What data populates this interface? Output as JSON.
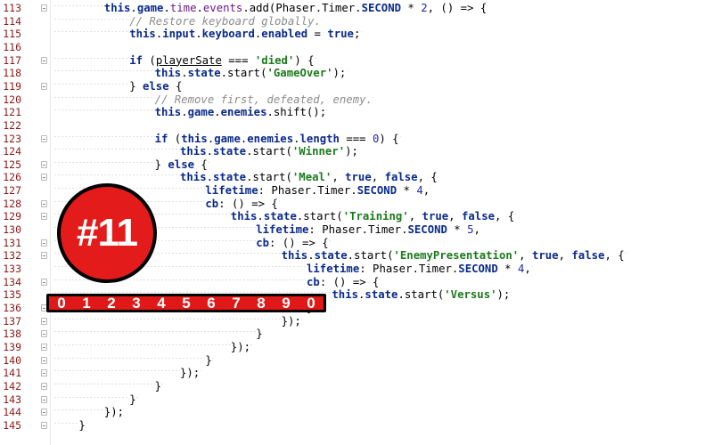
{
  "editor": {
    "lines": [
      {
        "n": "113",
        "indent": 8,
        "fold": true,
        "parts": [
          [
            "kw",
            "this"
          ],
          [
            "",
            "."
          ],
          [
            "kw",
            "game"
          ],
          [
            "",
            "."
          ],
          [
            "prop",
            "time"
          ],
          [
            "",
            "."
          ],
          [
            "prop",
            "events"
          ],
          [
            "",
            ".add(Phaser.Timer."
          ],
          [
            "kw",
            "SECOND"
          ],
          [
            "",
            " * "
          ],
          [
            "num",
            "2"
          ],
          [
            "",
            ", () => {"
          ]
        ]
      },
      {
        "n": "114",
        "indent": 12,
        "fold": false,
        "parts": [
          [
            "cmt",
            "// Restore keyboard globally."
          ]
        ]
      },
      {
        "n": "115",
        "indent": 12,
        "fold": false,
        "parts": [
          [
            "kw",
            "this"
          ],
          [
            "",
            "."
          ],
          [
            "kw",
            "input"
          ],
          [
            "",
            "."
          ],
          [
            "kw",
            "keyboard"
          ],
          [
            "",
            "."
          ],
          [
            "kw",
            "enabled"
          ],
          [
            "",
            " = "
          ],
          [
            "kw",
            "true"
          ],
          [
            "",
            ";"
          ]
        ]
      },
      {
        "n": "116",
        "indent": 0,
        "fold": false,
        "parts": []
      },
      {
        "n": "117",
        "indent": 12,
        "fold": true,
        "parts": [
          [
            "kw",
            "if"
          ],
          [
            "",
            " ("
          ],
          [
            "und",
            "playerSate"
          ],
          [
            "",
            " === "
          ],
          [
            "str",
            "'died'"
          ],
          [
            "",
            ") {"
          ]
        ]
      },
      {
        "n": "118",
        "indent": 16,
        "fold": false,
        "parts": [
          [
            "kw",
            "this"
          ],
          [
            "",
            "."
          ],
          [
            "kw",
            "state"
          ],
          [
            "",
            ".start("
          ],
          [
            "str",
            "'GameOver'"
          ],
          [
            "",
            ");"
          ]
        ]
      },
      {
        "n": "119",
        "indent": 12,
        "fold": true,
        "parts": [
          [
            "",
            "} "
          ],
          [
            "kw",
            "else"
          ],
          [
            "",
            " {"
          ]
        ]
      },
      {
        "n": "120",
        "indent": 16,
        "fold": false,
        "parts": [
          [
            "cmt",
            "// Remove first, defeated, enemy."
          ]
        ]
      },
      {
        "n": "121",
        "indent": 16,
        "fold": false,
        "parts": [
          [
            "kw",
            "this"
          ],
          [
            "",
            "."
          ],
          [
            "kw",
            "game"
          ],
          [
            "",
            "."
          ],
          [
            "kw",
            "enemies"
          ],
          [
            "",
            ".shift();"
          ]
        ]
      },
      {
        "n": "122",
        "indent": 0,
        "fold": false,
        "parts": []
      },
      {
        "n": "123",
        "indent": 16,
        "fold": true,
        "parts": [
          [
            "kw",
            "if"
          ],
          [
            "",
            " ("
          ],
          [
            "kw",
            "this"
          ],
          [
            "",
            "."
          ],
          [
            "kw",
            "game"
          ],
          [
            "",
            "."
          ],
          [
            "kw",
            "enemies"
          ],
          [
            "",
            "."
          ],
          [
            "kw",
            "length"
          ],
          [
            "",
            " === "
          ],
          [
            "num",
            "0"
          ],
          [
            "",
            ") {"
          ]
        ]
      },
      {
        "n": "124",
        "indent": 20,
        "fold": false,
        "parts": [
          [
            "kw",
            "this"
          ],
          [
            "",
            "."
          ],
          [
            "kw",
            "state"
          ],
          [
            "",
            ".start("
          ],
          [
            "str",
            "'Winner'"
          ],
          [
            "",
            ");"
          ]
        ]
      },
      {
        "n": "125",
        "indent": 16,
        "fold": true,
        "parts": [
          [
            "",
            "} "
          ],
          [
            "kw",
            "else"
          ],
          [
            "",
            " {"
          ]
        ]
      },
      {
        "n": "126",
        "indent": 20,
        "fold": true,
        "parts": [
          [
            "kw",
            "this"
          ],
          [
            "",
            "."
          ],
          [
            "kw",
            "state"
          ],
          [
            "",
            ".start("
          ],
          [
            "str",
            "'Meal'"
          ],
          [
            "",
            ", "
          ],
          [
            "kw",
            "true"
          ],
          [
            "",
            ", "
          ],
          [
            "kw",
            "false"
          ],
          [
            "",
            ", {"
          ]
        ]
      },
      {
        "n": "127",
        "indent": 24,
        "fold": false,
        "parts": [
          [
            "kw",
            "lifetime"
          ],
          [
            "",
            ": Phaser.Timer."
          ],
          [
            "kw",
            "SECOND"
          ],
          [
            "",
            " * "
          ],
          [
            "num",
            "4"
          ],
          [
            "",
            ","
          ]
        ]
      },
      {
        "n": "128",
        "indent": 24,
        "fold": true,
        "parts": [
          [
            "kw",
            "cb"
          ],
          [
            "",
            ": () => {"
          ]
        ]
      },
      {
        "n": "129",
        "indent": 28,
        "fold": true,
        "parts": [
          [
            "kw",
            "this"
          ],
          [
            "",
            "."
          ],
          [
            "kw",
            "state"
          ],
          [
            "",
            ".start("
          ],
          [
            "str",
            "'Training'"
          ],
          [
            "",
            ", "
          ],
          [
            "kw",
            "true"
          ],
          [
            "",
            ", "
          ],
          [
            "kw",
            "false"
          ],
          [
            "",
            ", {"
          ]
        ]
      },
      {
        "n": "130",
        "indent": 32,
        "fold": false,
        "parts": [
          [
            "kw",
            "lifetime"
          ],
          [
            "",
            ": Phaser.Timer."
          ],
          [
            "kw",
            "SECOND"
          ],
          [
            "",
            " * "
          ],
          [
            "num",
            "5"
          ],
          [
            "",
            ","
          ]
        ]
      },
      {
        "n": "131",
        "indent": 32,
        "fold": true,
        "parts": [
          [
            "kw",
            "cb"
          ],
          [
            "",
            ": () => {"
          ]
        ]
      },
      {
        "n": "132",
        "indent": 36,
        "fold": true,
        "parts": [
          [
            "kw",
            "this"
          ],
          [
            "",
            "."
          ],
          [
            "kw",
            "state"
          ],
          [
            "",
            ".start("
          ],
          [
            "str",
            "'EnemyPresentation'"
          ],
          [
            "",
            ", "
          ],
          [
            "kw",
            "true"
          ],
          [
            "",
            ", "
          ],
          [
            "kw",
            "false"
          ],
          [
            "",
            ", {"
          ]
        ]
      },
      {
        "n": "133",
        "indent": 40,
        "fold": false,
        "parts": [
          [
            "kw",
            "lifetime"
          ],
          [
            "",
            ": Phaser.Timer."
          ],
          [
            "kw",
            "SECOND"
          ],
          [
            "",
            " * "
          ],
          [
            "num",
            "4"
          ],
          [
            "",
            ","
          ]
        ]
      },
      {
        "n": "134",
        "indent": 40,
        "fold": true,
        "parts": [
          [
            "kw",
            "cb"
          ],
          [
            "",
            ": () => {"
          ]
        ]
      },
      {
        "n": "135",
        "indent": 44,
        "fold": false,
        "parts": [
          [
            "kw",
            "this"
          ],
          [
            "",
            "."
          ],
          [
            "kw",
            "state"
          ],
          [
            "",
            ".start("
          ],
          [
            "str",
            "'Versus'"
          ],
          [
            "",
            ");"
          ]
        ]
      },
      {
        "n": "136",
        "indent": 40,
        "fold": true,
        "parts": [
          [
            "",
            "}"
          ]
        ]
      },
      {
        "n": "137",
        "indent": 36,
        "fold": true,
        "parts": [
          [
            "",
            "});"
          ]
        ]
      },
      {
        "n": "138",
        "indent": 32,
        "fold": true,
        "parts": [
          [
            "",
            "}"
          ]
        ]
      },
      {
        "n": "139",
        "indent": 28,
        "fold": true,
        "parts": [
          [
            "",
            "});"
          ]
        ]
      },
      {
        "n": "140",
        "indent": 24,
        "fold": true,
        "parts": [
          [
            "",
            "}"
          ]
        ]
      },
      {
        "n": "141",
        "indent": 20,
        "fold": true,
        "parts": [
          [
            "",
            "});"
          ]
        ]
      },
      {
        "n": "142",
        "indent": 16,
        "fold": true,
        "parts": [
          [
            "",
            "}"
          ]
        ]
      },
      {
        "n": "143",
        "indent": 12,
        "fold": true,
        "parts": [
          [
            "",
            "}"
          ]
        ]
      },
      {
        "n": "144",
        "indent": 8,
        "fold": true,
        "parts": [
          [
            "",
            "});"
          ]
        ]
      },
      {
        "n": "145",
        "indent": 4,
        "fold": true,
        "parts": [
          [
            "",
            "}"
          ]
        ]
      }
    ]
  },
  "overlay": {
    "badge_text": "#11",
    "ruler_digits": [
      "0",
      "1",
      "2",
      "3",
      "4",
      "5",
      "6",
      "7",
      "8",
      "9",
      "0"
    ]
  },
  "colors": {
    "keyword": "#0a2a8a",
    "string": "#1c7a1c",
    "comment": "#8c8c8c",
    "line_number": "#8a1a1a",
    "overlay_red": "#e31b1b"
  }
}
